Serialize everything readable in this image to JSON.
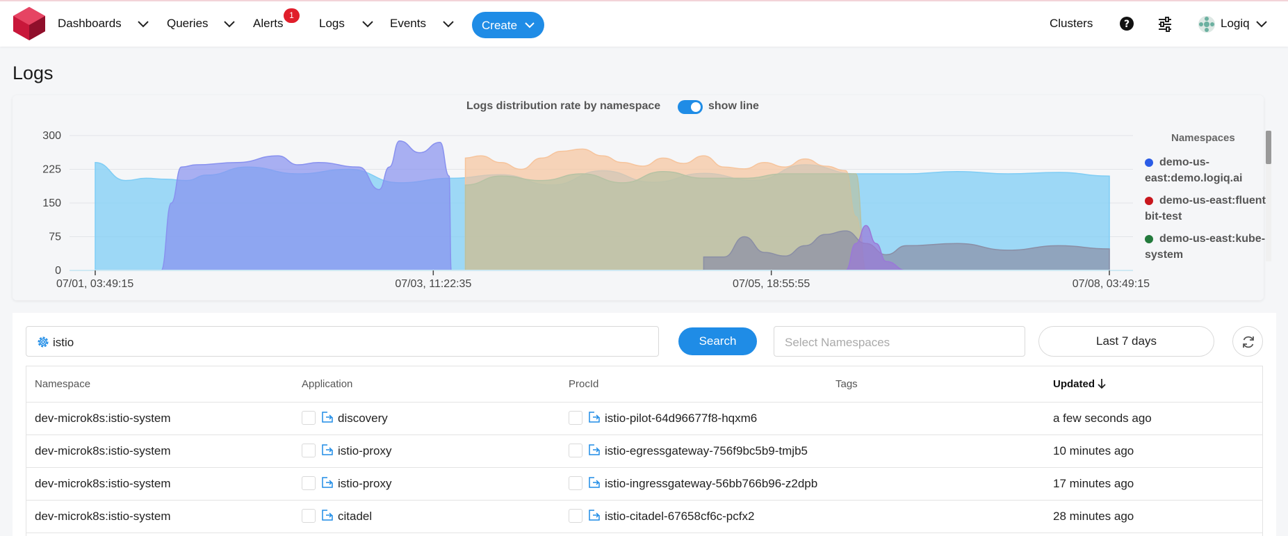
{
  "nav": {
    "dashboards": "Dashboards",
    "queries": "Queries",
    "alerts": "Alerts",
    "alerts_badge": "1",
    "logs": "Logs",
    "events": "Events",
    "create": "Create",
    "clusters": "Clusters",
    "user": "Logiq"
  },
  "page": {
    "title": "Logs"
  },
  "chart_panel": {
    "toggle_label": "show line",
    "toggle_on": true,
    "legend_title": "Namespaces"
  },
  "chart_data": {
    "type": "area",
    "title": "Logs distribution rate by namespace",
    "ylim": [
      0,
      300
    ],
    "y_ticks": [
      "300",
      "225",
      "150",
      "75",
      "0"
    ],
    "x_ticks": [
      "07/01, 03:49:15",
      "07/03, 11:22:35",
      "07/05, 18:55:55",
      "07/08, 03:49:15"
    ],
    "x_range": [
      "07/01 03:49:15",
      "07/08 03:49:15"
    ],
    "legend_position": "right",
    "grid": true,
    "legend": [
      {
        "name": "demo-us-east:demo.logiq.ai",
        "color": "#2b5ce6"
      },
      {
        "name": "demo-us-east:fluent-bit-test",
        "color": "#c8161d"
      },
      {
        "name": "demo-us-east:kube-system",
        "color": "#237a3c"
      }
    ],
    "series": [
      {
        "color": "#7fcdf5",
        "x": [
          0,
          0.03,
          0.05,
          0.07,
          0.09,
          0.11,
          0.15,
          0.2,
          0.25,
          0.3,
          0.35,
          0.4,
          0.45,
          0.5,
          0.55,
          0.6,
          0.65,
          0.7,
          0.75,
          0.8,
          0.85,
          0.9,
          0.95,
          1.0
        ],
        "y": [
          240,
          200,
          205,
          203,
          200,
          212,
          230,
          215,
          225,
          195,
          205,
          213,
          190,
          222,
          196,
          216,
          200,
          235,
          215,
          215,
          220,
          215,
          218,
          210
        ]
      },
      {
        "color": "#8891ef",
        "x": [
          0,
          0.065,
          0.075,
          0.085,
          0.1,
          0.14,
          0.18,
          0.2,
          0.22,
          0.26,
          0.28,
          0.29,
          0.3,
          0.32,
          0.34,
          0.349,
          0.351
        ],
        "y": [
          0,
          0,
          150,
          230,
          235,
          240,
          255,
          235,
          240,
          230,
          180,
          230,
          288,
          262,
          285,
          210,
          0
        ]
      },
      {
        "color": "#f6c49c",
        "x": [
          0.365,
          0.38,
          0.4,
          0.42,
          0.44,
          0.46,
          0.48,
          0.5,
          0.52,
          0.54,
          0.56,
          0.58,
          0.6,
          0.62,
          0.64,
          0.66,
          0.68,
          0.7,
          0.72,
          0.74,
          0.75,
          0.76
        ],
        "y": [
          250,
          255,
          240,
          225,
          250,
          265,
          270,
          255,
          240,
          232,
          250,
          238,
          255,
          230,
          226,
          240,
          230,
          248,
          232,
          222,
          120,
          0
        ]
      },
      {
        "color": "#b7c2a4",
        "x": [
          0.365,
          0.4,
          0.44,
          0.48,
          0.52,
          0.56,
          0.6,
          0.64,
          0.68,
          0.72,
          0.75,
          0.76
        ],
        "y": [
          190,
          210,
          200,
          215,
          195,
          220,
          205,
          205,
          215,
          215,
          215,
          0
        ]
      },
      {
        "color": "#8a8ea5",
        "x": [
          0.6,
          0.62,
          0.64,
          0.66,
          0.68,
          0.7,
          0.72,
          0.74,
          0.76,
          0.78,
          0.8,
          0.85,
          0.9,
          0.95,
          1.0
        ],
        "y": [
          30,
          30,
          75,
          40,
          32,
          55,
          80,
          88,
          60,
          35,
          55,
          60,
          45,
          55,
          48
        ]
      },
      {
        "color": "#9a78d8",
        "x": [
          0.74,
          0.75,
          0.76,
          0.77,
          0.78,
          0.8
        ],
        "y": [
          0,
          60,
          100,
          60,
          20,
          0
        ]
      }
    ]
  },
  "search": {
    "query": "istio",
    "button": "Search",
    "namespace_placeholder": "Select Namespaces",
    "time_range": "Last 7 days"
  },
  "table": {
    "columns": [
      "Namespace",
      "Application",
      "ProcId",
      "Tags",
      "Updated"
    ],
    "rows": [
      {
        "namespace": "dev-microk8s:istio-system",
        "application": "discovery",
        "procid": "istio-pilot-64d96677f8-hqxm6",
        "updated": "a few seconds ago"
      },
      {
        "namespace": "dev-microk8s:istio-system",
        "application": "istio-proxy",
        "procid": "istio-egressgateway-756f9bc5b9-tmjb5",
        "updated": "10 minutes ago"
      },
      {
        "namespace": "dev-microk8s:istio-system",
        "application": "istio-proxy",
        "procid": "istio-ingressgateway-56bb766b96-z2dpb",
        "updated": "17 minutes ago"
      },
      {
        "namespace": "dev-microk8s:istio-system",
        "application": "citadel",
        "procid": "istio-citadel-67658cf6c-pcfx2",
        "updated": "28 minutes ago"
      }
    ]
  }
}
